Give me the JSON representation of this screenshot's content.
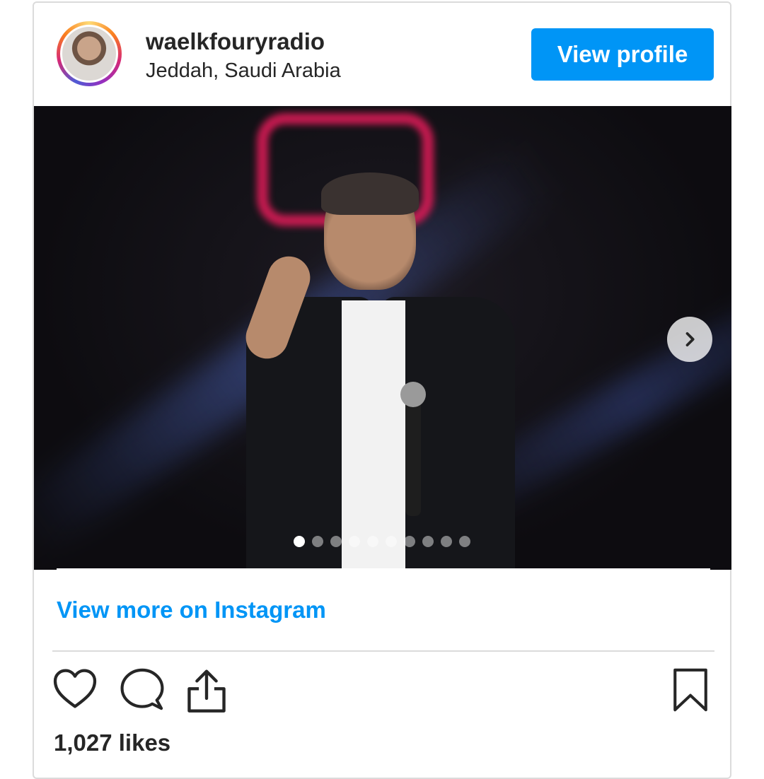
{
  "post": {
    "username": "waelkfouryradio",
    "location": "Jeddah, Saudi Arabia",
    "view_profile_label": "View profile",
    "view_more_label": "View more on Instagram",
    "likes": "1,027 likes"
  },
  "carousel": {
    "total_slides": 10,
    "current_slide": 1
  },
  "icons": {
    "like": "heart-icon",
    "comment": "comment-icon",
    "share": "share-icon",
    "save": "bookmark-icon",
    "next": "chevron-right-icon"
  },
  "colors": {
    "accent": "#0095f6",
    "text": "#262626",
    "border": "#dbdbdb"
  }
}
